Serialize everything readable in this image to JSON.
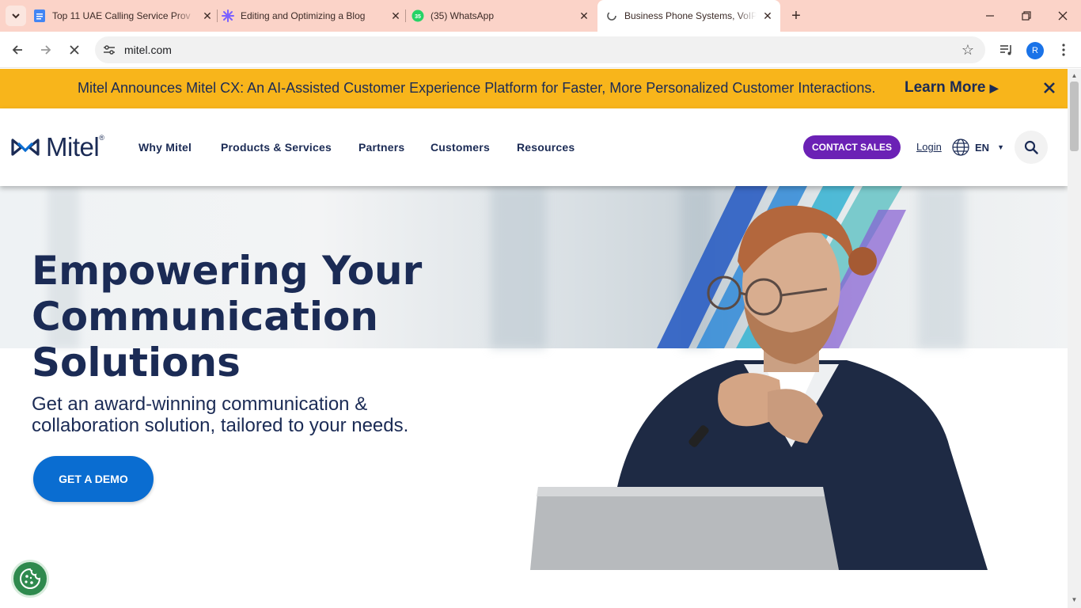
{
  "browser": {
    "tabs": [
      {
        "title": "Top 11 UAE Calling Service Prov",
        "favicon": "docs-icon"
      },
      {
        "title": "Editing and Optimizing a Blog",
        "favicon": "ai-star-icon"
      },
      {
        "title": "(35) WhatsApp",
        "favicon": "whatsapp-icon",
        "badge": "35"
      },
      {
        "title": "Business Phone Systems, VoIP,",
        "favicon": "loading-icon"
      }
    ],
    "url": "mitel.com",
    "profile_initial": "R"
  },
  "announcement": {
    "message": "Mitel Announces Mitel CX: An AI-Assisted Customer Experience Platform for Faster, More Personalized Customer Interactions.",
    "link": "Learn More"
  },
  "header": {
    "brand": "Mitel",
    "nav": [
      "Why Mitel",
      "Products & Services",
      "Partners",
      "Customers",
      "Resources"
    ],
    "contact": "CONTACT SALES",
    "login": "Login",
    "language": "EN"
  },
  "hero": {
    "title_lines": [
      "Empowering Your",
      "Communication",
      "Solutions"
    ],
    "subtitle": "Get an award-winning communication & collaboration solution, tailored to your needs.",
    "cta": "GET A DEMO"
  },
  "colors": {
    "tabbar": "#fbd3c8",
    "announcement_bg": "#f8b51b",
    "navy": "#1b2b55",
    "contact_purple": "#6b21b5",
    "cta_blue": "#0a6dd1",
    "cookie_green": "#2f8a4e"
  }
}
